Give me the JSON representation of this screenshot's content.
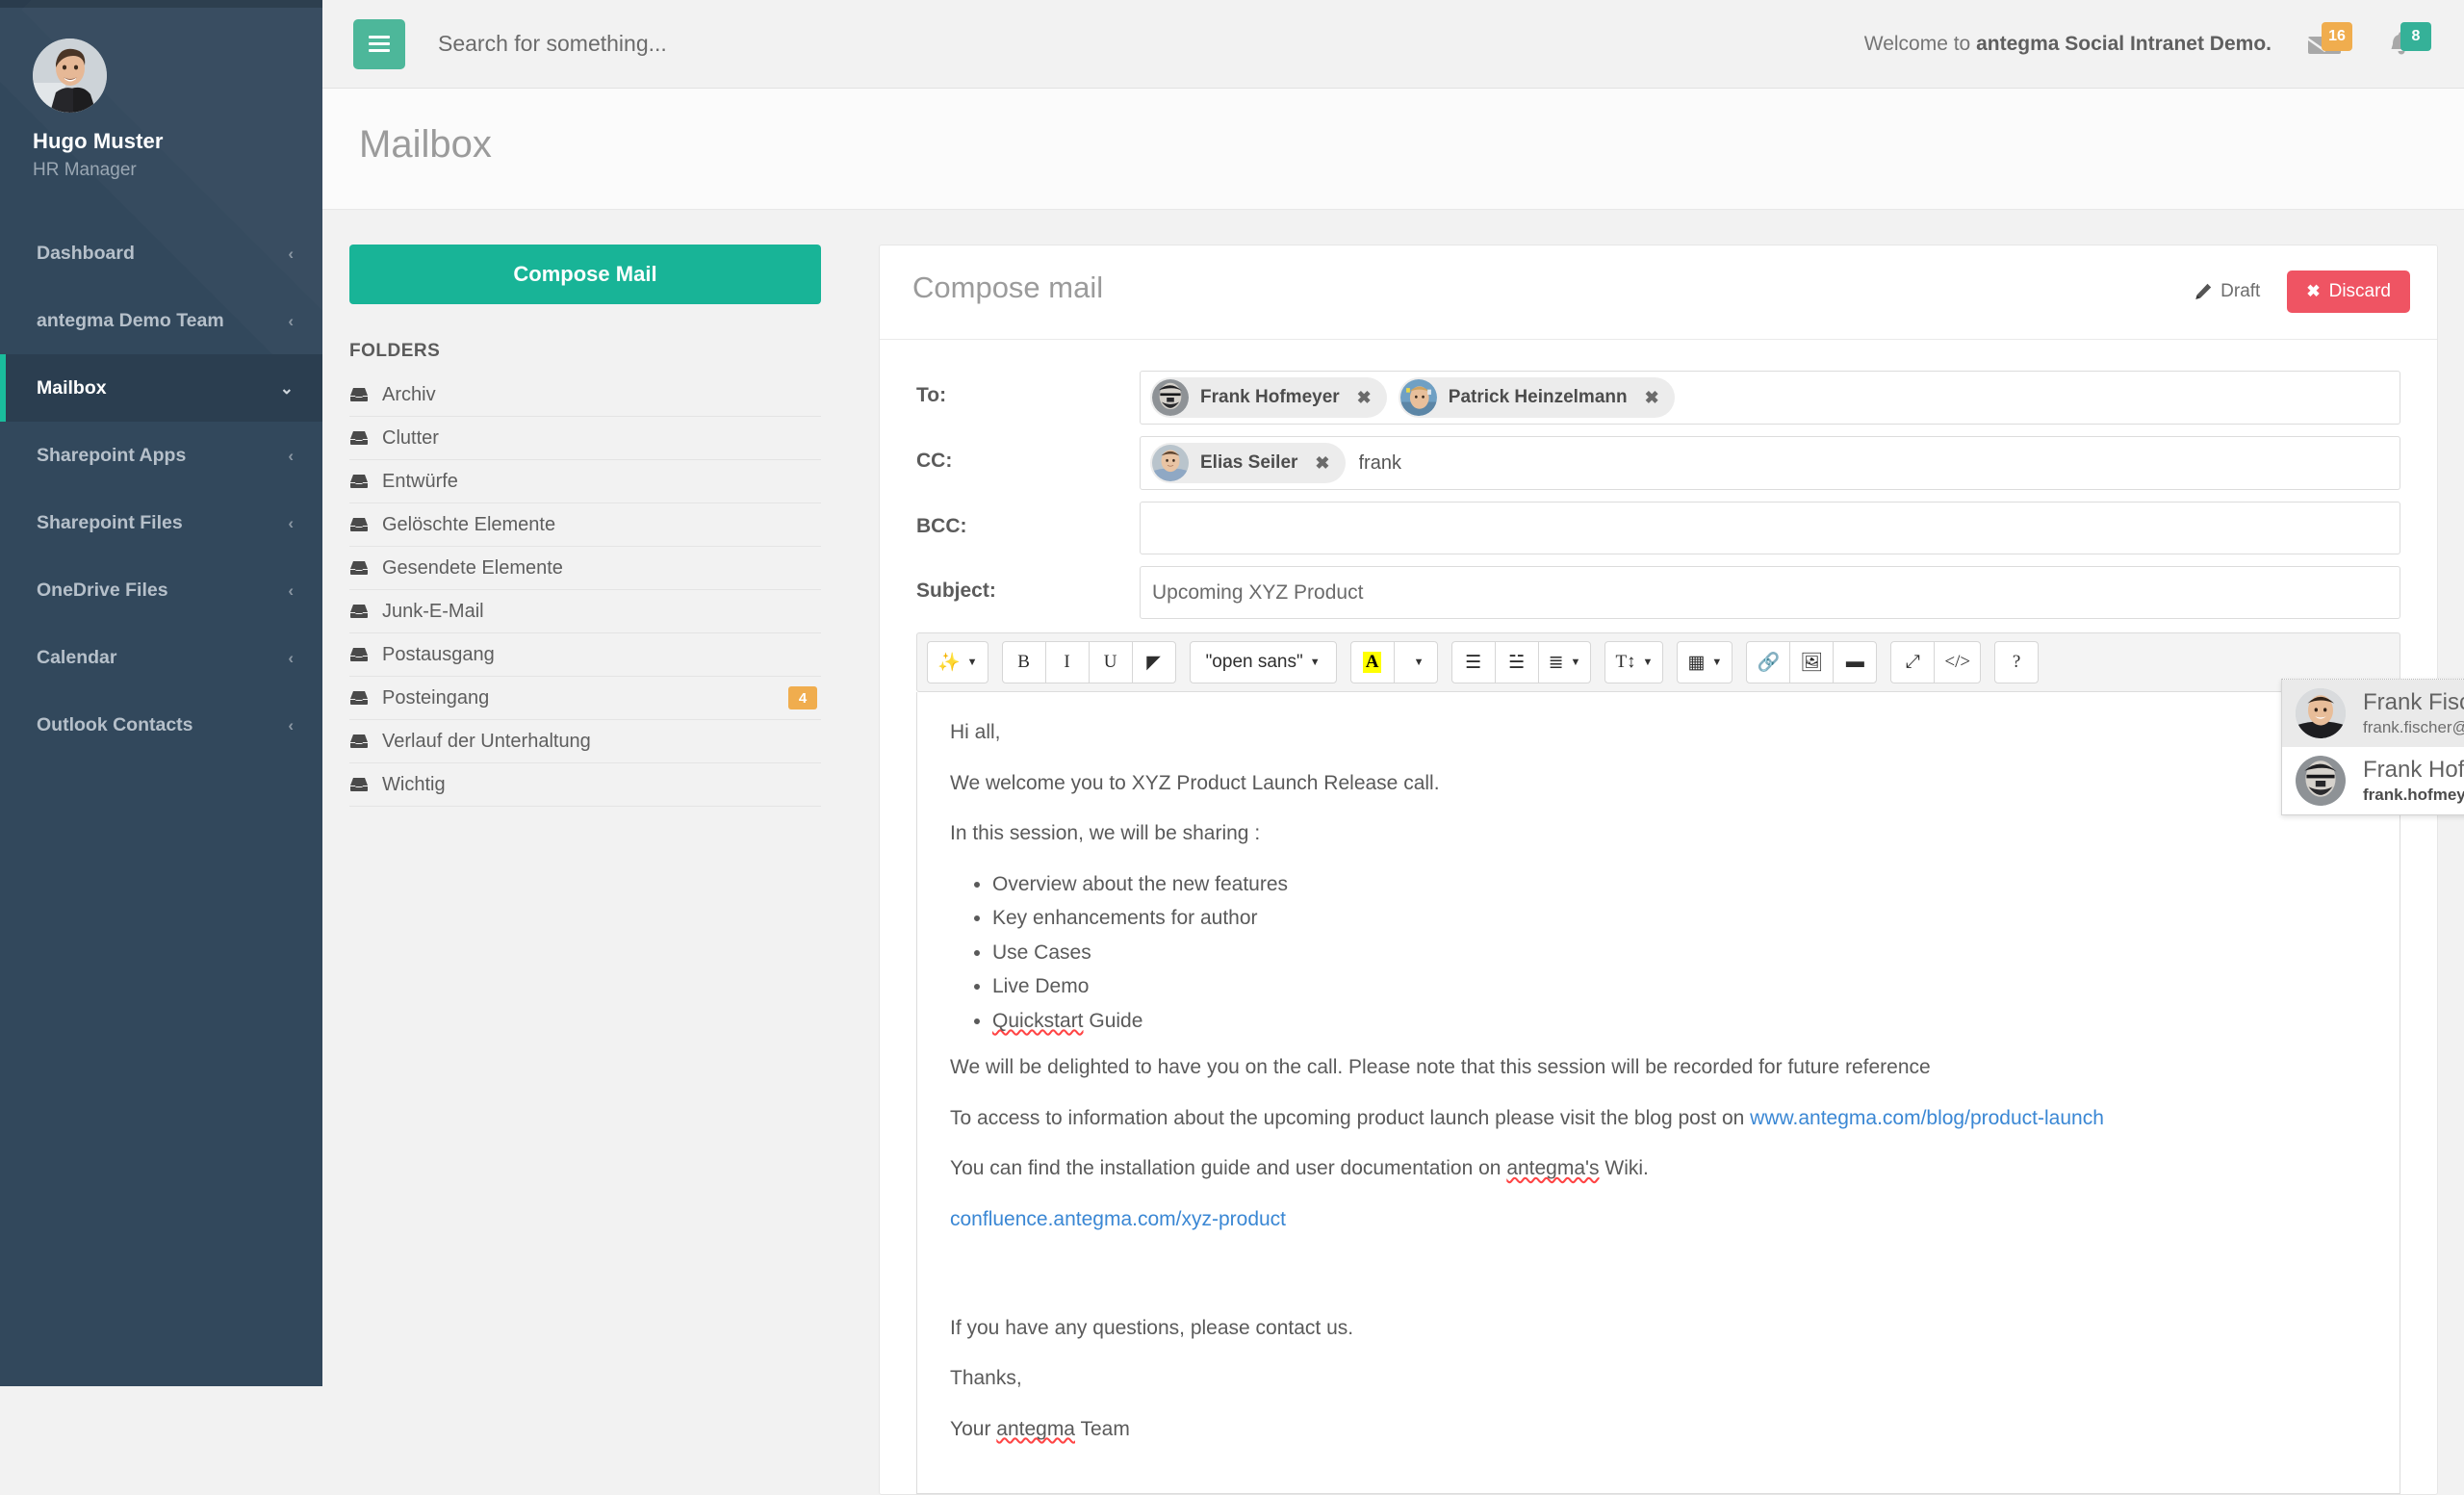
{
  "sidebar": {
    "profile": {
      "name": "Hugo Muster",
      "role": "HR Manager",
      "avatar_icon": "user-photo"
    },
    "items": [
      {
        "label": "Dashboard",
        "caret": "‹",
        "active": false
      },
      {
        "label": "antegma Demo Team",
        "caret": "‹",
        "active": false
      },
      {
        "label": "Mailbox",
        "caret": "⌄",
        "active": true
      },
      {
        "label": "Sharepoint Apps",
        "caret": "‹",
        "active": false
      },
      {
        "label": "Sharepoint Files",
        "caret": "‹",
        "active": false
      },
      {
        "label": "OneDrive Files",
        "caret": "‹",
        "active": false
      },
      {
        "label": "Calendar",
        "caret": "‹",
        "active": false
      },
      {
        "label": "Outlook Contacts",
        "caret": "‹",
        "active": false
      }
    ],
    "accent_color": "#1abc9c",
    "bg_color": "#32485c"
  },
  "topbar": {
    "menu_icon": "hamburger-icon",
    "search_placeholder": "Search for something...",
    "search_value": "",
    "welcome_prefix": "Welcome to ",
    "welcome_brand": "antegma Social Intranet Demo.",
    "mail_badge": "16",
    "mail_badge_color": "#f0ad4e",
    "bell_badge": "8",
    "bell_badge_color": "#35b198"
  },
  "page": {
    "title": "Mailbox"
  },
  "mail_left": {
    "compose_label": "Compose Mail",
    "compose_color": "#18b497",
    "folders_label": "FOLDERS",
    "folders": [
      {
        "name": "Archiv",
        "count": ""
      },
      {
        "name": "Clutter",
        "count": ""
      },
      {
        "name": "Entwürfe",
        "count": ""
      },
      {
        "name": "Gelöschte Elemente",
        "count": ""
      },
      {
        "name": "Gesendete Elemente",
        "count": ""
      },
      {
        "name": "Junk-E-Mail",
        "count": ""
      },
      {
        "name": "Postausgang",
        "count": ""
      },
      {
        "name": "Posteingang",
        "count": "4"
      },
      {
        "name": "Verlauf der Unterhaltung",
        "count": ""
      },
      {
        "name": "Wichtig",
        "count": ""
      }
    ]
  },
  "compose": {
    "title": "Compose mail",
    "draft_label": "Draft",
    "discard_label": "Discard",
    "discard_color": "#ef5463",
    "labels": {
      "to": "To:",
      "cc": "CC:",
      "bcc": "BCC:",
      "subject": "Subject:"
    },
    "to_chips": [
      {
        "name": "Frank Hofmeyer"
      },
      {
        "name": "Patrick Heinzelmann"
      }
    ],
    "cc_chips": [
      {
        "name": "Elias Seiler"
      }
    ],
    "cc_input_value": "frank",
    "bcc_chips": [],
    "bcc_input_value": "",
    "subject_value": "Upcoming XYZ Product",
    "autocomplete": {
      "items": [
        {
          "name": "Frank Fischer",
          "email": "frank.fischer@antegma.com",
          "selected": true
        },
        {
          "name": "Frank Hofmeyer",
          "email": "frank.hofmeyer@antegma.com",
          "selected": false
        }
      ]
    }
  },
  "toolbar": {
    "groups": [
      {
        "buttons": [
          {
            "icon": "magic-wand-icon",
            "glyph": "✨",
            "caret": true
          }
        ]
      },
      {
        "buttons": [
          {
            "icon": "bold-icon",
            "glyph": "B",
            "caret": false
          },
          {
            "icon": "italic-icon",
            "glyph": "I",
            "caret": false
          },
          {
            "icon": "underline-icon",
            "glyph": "U",
            "caret": false
          },
          {
            "icon": "eraser-icon",
            "glyph": "◤",
            "caret": false
          }
        ]
      },
      {
        "buttons": [
          {
            "icon": "font-family-select",
            "glyph": "\"open sans\"",
            "caret": true,
            "wide": true
          }
        ]
      },
      {
        "buttons": [
          {
            "icon": "font-color-icon",
            "glyph": "A",
            "caret": false,
            "highlight": true
          },
          {
            "icon": "font-color-caret-icon",
            "glyph": "",
            "caret": true
          }
        ]
      },
      {
        "buttons": [
          {
            "icon": "unordered-list-icon",
            "glyph": "☰",
            "caret": false
          },
          {
            "icon": "ordered-list-icon",
            "glyph": "☱",
            "caret": false
          },
          {
            "icon": "align-icon",
            "glyph": "≣",
            "caret": true
          }
        ]
      },
      {
        "buttons": [
          {
            "icon": "line-height-icon",
            "glyph": "T↕",
            "caret": true
          }
        ]
      },
      {
        "buttons": [
          {
            "icon": "table-icon",
            "glyph": "▦",
            "caret": true
          }
        ]
      },
      {
        "buttons": [
          {
            "icon": "link-icon",
            "glyph": "🔗",
            "caret": false
          },
          {
            "icon": "image-icon",
            "glyph": "🖼",
            "caret": false
          },
          {
            "icon": "horizontal-rule-icon",
            "glyph": "▬",
            "caret": false
          }
        ]
      },
      {
        "buttons": [
          {
            "icon": "fullscreen-icon",
            "glyph": "⤢",
            "caret": false
          },
          {
            "icon": "code-view-icon",
            "glyph": "</>",
            "caret": false
          }
        ]
      },
      {
        "buttons": [
          {
            "icon": "help-icon",
            "glyph": "?",
            "caret": false
          }
        ]
      }
    ],
    "font_value": "\"open sans\""
  },
  "email_body": {
    "greeting": "Hi all,",
    "para1": "We welcome you to XYZ Product Launch Release call.",
    "para2": "In this session, we will be sharing :",
    "bullets": [
      "Overview about the new features",
      "Key enhancements for author",
      "Use Cases",
      "Live Demo",
      "Quickstart Guide"
    ],
    "para3": "We will be delighted to have you on the call. Please note that this session will be recorded for future reference",
    "para4_prefix": "To access to information about the upcoming product launch please visit the blog post on ",
    "para4_link": "www.antegma.com/blog/product-launch",
    "para5_prefix": "You can find the installation guide and user documentation on ",
    "para5_spell": "antegma's",
    "para5_suffix": " Wiki.",
    "link2": "confluence.antegma.com/xyz-product",
    "para6": "If you have any questions, please contact us.",
    "para7": "Thanks,",
    "signature_prefix": "Your ",
    "signature_spell": "antegma",
    "signature_suffix": " Team"
  }
}
